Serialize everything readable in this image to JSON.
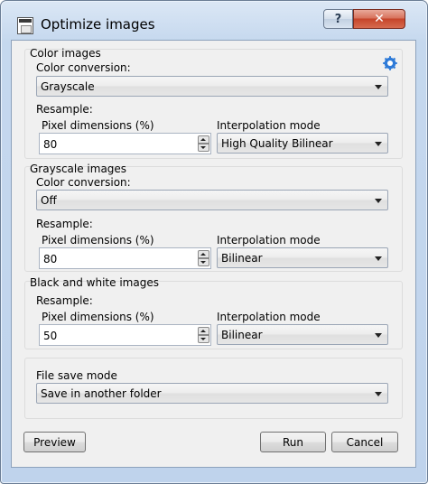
{
  "window": {
    "title": "Optimize images",
    "help": "?",
    "close": "✕"
  },
  "color": {
    "group_label": "Color images",
    "conversion_label": "Color conversion:",
    "conversion_value": "Grayscale",
    "resample_label": "Resample:",
    "pixel_label": "Pixel dimensions (%)",
    "pixel_value": "80",
    "interp_label": "Interpolation mode",
    "interp_value": "High Quality Bilinear"
  },
  "grayscale": {
    "group_label": "Grayscale images",
    "conversion_label": "Color conversion:",
    "conversion_value": "Off",
    "resample_label": "Resample:",
    "pixel_label": "Pixel dimensions (%)",
    "pixel_value": "80",
    "interp_label": "Interpolation mode",
    "interp_value": "Bilinear"
  },
  "bw": {
    "group_label": "Black and white images",
    "resample_label": "Resample:",
    "pixel_label": "Pixel dimensions (%)",
    "pixel_value": "50",
    "interp_label": "Interpolation mode",
    "interp_value": "Bilinear"
  },
  "save": {
    "mode_label": "File save mode",
    "mode_value": "Save in another folder"
  },
  "buttons": {
    "preview": "Preview",
    "run": "Run",
    "cancel": "Cancel"
  },
  "icons": {
    "settings": "gear-icon",
    "app": "app-icon"
  },
  "colors": {
    "accent": "#2f7bd8",
    "close": "#c6442a"
  }
}
